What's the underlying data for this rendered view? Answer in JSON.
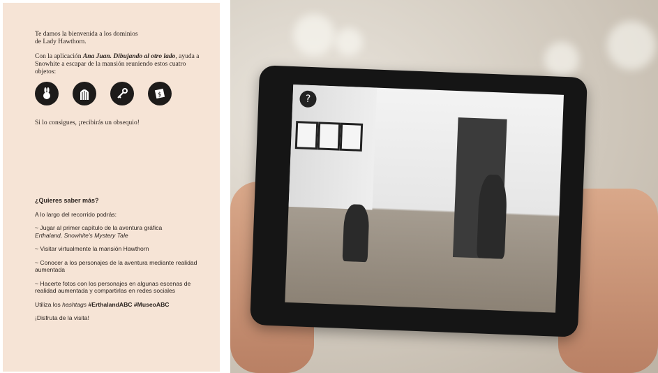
{
  "brochure": {
    "intro_line1": "Te damos la bienvenida a los dominios",
    "intro_line2": "de Lady Hawthorn.",
    "intro2_prefix": "Con la aplicación ",
    "app_name": "Ana Juan. Dibujando al otro lado",
    "intro2_suffix": ", ayuda a Snowhite a escapar de la mansión reuniendo estos cuatro objetos:",
    "icons": [
      "rabbit-icon",
      "cage-icon",
      "key-icon",
      "note-icon"
    ],
    "reward": "Si lo consigues, ¡recibirás un obsequio!",
    "more_heading": "¿Quieres saber más?",
    "more_intro": "A lo largo del recorrido podrás:",
    "bullet1_plain": "~ Jugar al primer capítulo de la aventura gráfica",
    "bullet1_italic": "Erthaland, Snowhite's Mystery Tale",
    "bullet2": "~ Visitar virtualmente la mansión Hawthorn",
    "bullet3": "~ Conocer a los personajes de la aventura mediante realidad aumentada",
    "bullet4": "~ Hacerte fotos con los personajes en algunas escenas de realidad aumentada y compartirlas en redes sociales",
    "hashtags_prefix": "Utiliza los ",
    "hashtags_word": "hashtags",
    "hashtag1": "#ErthalandABC",
    "hashtag2": "#MuseoABC",
    "farewell": "¡Disfruta de la visita!"
  },
  "photo": {
    "help_button": "?"
  }
}
